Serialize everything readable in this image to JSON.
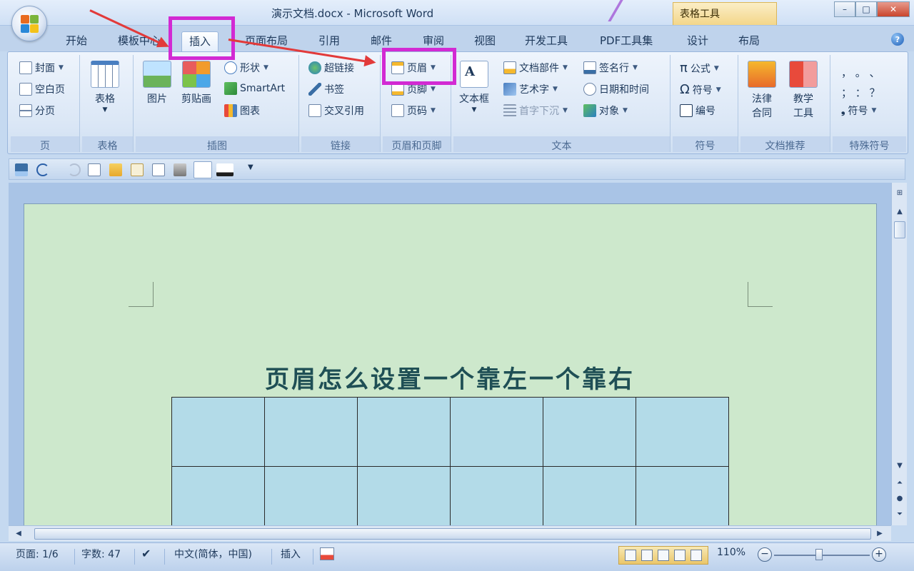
{
  "window": {
    "title": "演示文档.docx - Microsoft Word",
    "context_tab_group": "表格工具",
    "controls": {
      "minimize": "–",
      "maximize": "□",
      "close": "✕"
    }
  },
  "tabs": [
    {
      "label": "开始"
    },
    {
      "label": "模板中心"
    },
    {
      "label": "插入",
      "active": true
    },
    {
      "label": "页面布局"
    },
    {
      "label": "引用"
    },
    {
      "label": "邮件"
    },
    {
      "label": "审阅"
    },
    {
      "label": "视图"
    },
    {
      "label": "开发工具"
    },
    {
      "label": "PDF工具集"
    },
    {
      "label": "设计"
    },
    {
      "label": "布局"
    }
  ],
  "ribbon": {
    "page": {
      "label": "页",
      "items": [
        "封面",
        "空白页",
        "分页"
      ]
    },
    "table": {
      "label": "表格",
      "button": "表格"
    },
    "illustrations": {
      "label": "插图",
      "picture": "图片",
      "clipart": "剪贴画",
      "shapes": "形状",
      "smartart": "SmartArt",
      "chart": "图表"
    },
    "links": {
      "label": "链接",
      "hyperlink": "超链接",
      "bookmark": "书签",
      "crossref": "交叉引用"
    },
    "header_footer": {
      "label": "页眉和页脚",
      "header": "页眉",
      "footer": "页脚",
      "page_number": "页码"
    },
    "text": {
      "label": "文本",
      "textbox": "文本框",
      "quickparts": "文档部件",
      "wordart": "艺术字",
      "dropcap": "首字下沉",
      "signature": "签名行",
      "datetime": "日期和时间",
      "object": "对象"
    },
    "symbols": {
      "label": "符号",
      "equation": "公式",
      "symbol": "符号",
      "numbering": "编号",
      "pi": "π",
      "omega": "Ω"
    },
    "recommend": {
      "label": "文档推荐",
      "law": "法律合同",
      "teach": "教学工具"
    },
    "special": {
      "label": "特殊符号",
      "row1": "，  。  、",
      "row2": "；  ：  ？",
      "symbol_btn": "符号"
    }
  },
  "document": {
    "title": "页眉怎么设置一个靠左一个靠右",
    "rows": 2,
    "cols": 6
  },
  "status": {
    "page": "页面: 1/6",
    "words": "字数: 47",
    "language": "中文(简体，中国)",
    "mode": "插入",
    "zoom": "110%",
    "zoom_out": "−",
    "zoom_in": "+",
    "zoom_fraction": 0.47
  },
  "colors": {
    "highlight": "#d22ad3",
    "arrow": "#e23a3a"
  }
}
